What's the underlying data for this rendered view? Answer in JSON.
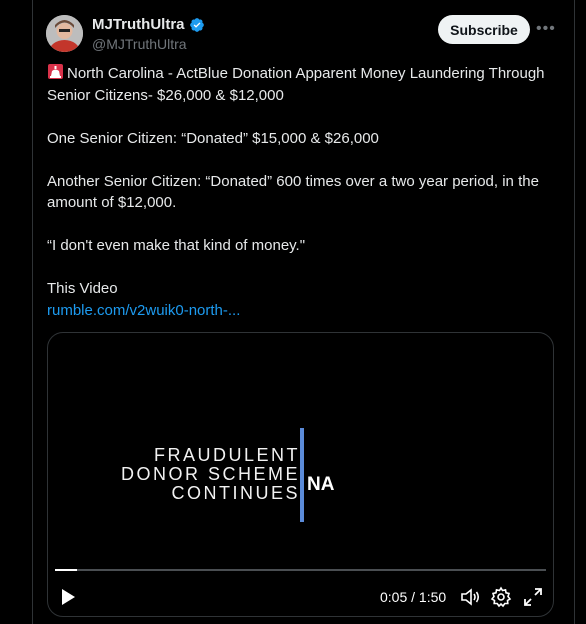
{
  "author": {
    "display_name": "MJTruthUltra",
    "handle": "@MJTruthUltra",
    "verified": true
  },
  "actions": {
    "subscribe_label": "Subscribe",
    "more_label": "•••"
  },
  "tweet": {
    "line1": "North Carolina - ActBlue Donation Apparent Money Laundering Through Senior Citizens- $26,000 & $12,000",
    "line2": "One Senior Citizen: “Donated” $15,000 & $26,000",
    "line3": "Another Senior Citizen: “Donated” 600 times over a two year period, in the amount of $12,000.",
    "line4": "“I don't even make that kind of money.\"",
    "line5": "This Video",
    "link": "rumble.com/v2wuik0-north-..."
  },
  "video": {
    "overlay_line1": "FRAUDULENT",
    "overlay_line2": "DONOR SCHEME",
    "overlay_line3": "CONTINUES",
    "overlay_suffix": "NA",
    "time_display": "0:05 / 1:50",
    "progress_fraction": 0.045
  },
  "colors": {
    "link": "#1d9bf0",
    "verified": "#1d9bf0",
    "accent_bar": "#5b8bd9"
  }
}
